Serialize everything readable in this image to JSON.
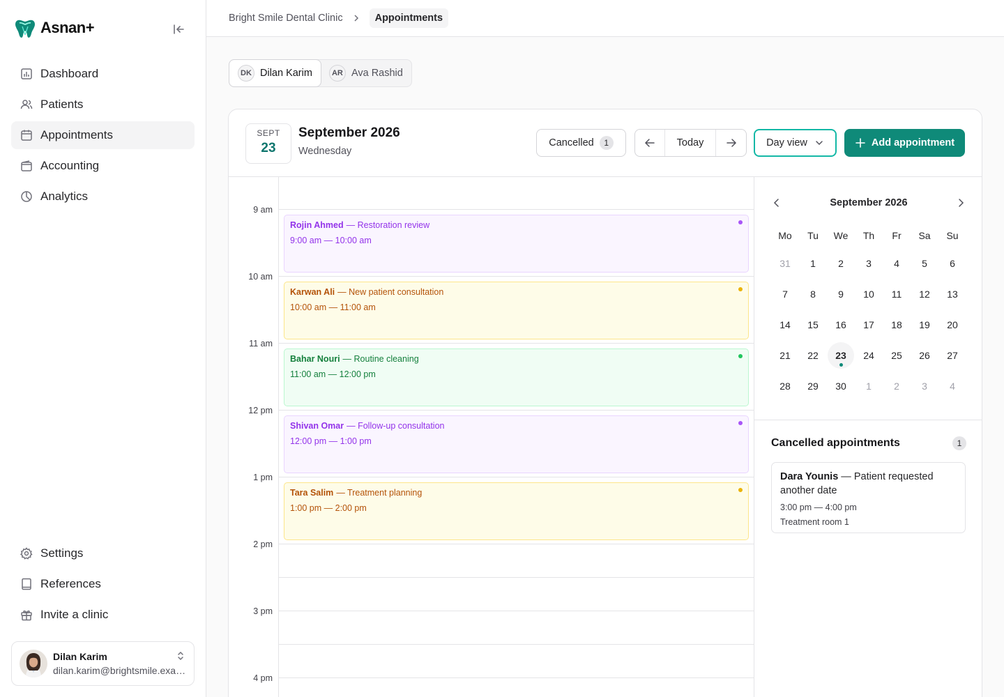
{
  "brand": {
    "name": "Asnan+"
  },
  "sidebar": {
    "items": [
      {
        "label": "Dashboard",
        "icon": "chart-icon"
      },
      {
        "label": "Patients",
        "icon": "users-icon"
      },
      {
        "label": "Appointments",
        "icon": "calendar-icon",
        "active": true
      },
      {
        "label": "Accounting",
        "icon": "wallet-icon"
      },
      {
        "label": "Analytics",
        "icon": "pie-chart-icon"
      }
    ],
    "bottom_items": [
      {
        "label": "Settings",
        "icon": "gear-icon"
      },
      {
        "label": "References",
        "icon": "book-icon"
      },
      {
        "label": "Invite a clinic",
        "icon": "gift-icon"
      }
    ],
    "user": {
      "name": "Dilan Karim",
      "email": "dilan.karim@brightsmile.example"
    }
  },
  "breadcrumb": {
    "clinic": "Bright Smile Dental Clinic",
    "current": "Appointments"
  },
  "doctors": [
    {
      "initials": "DK",
      "name": "Dilan Karim",
      "active": true
    },
    {
      "initials": "AR",
      "name": "Ava Rashid",
      "active": false
    }
  ],
  "calendar_header": {
    "badge_month": "SEPT",
    "badge_day": "23",
    "title": "September 2026",
    "weekday": "Wednesday",
    "cancelled_label": "Cancelled",
    "cancelled_count": "1",
    "today_label": "Today",
    "view_label": "Day view",
    "add_label": "Add appointment"
  },
  "time_labels": [
    "9 am",
    "10 am",
    "11 am",
    "12 pm",
    "1 pm",
    "2 pm",
    "3 pm",
    "4 pm"
  ],
  "events": [
    {
      "patient": "Rojin Ahmed",
      "title": "— Restoration review",
      "time": "9:00 am — 10:00 am",
      "color": "purple"
    },
    {
      "patient": "Karwan Ali",
      "title": "— New patient consultation",
      "time": "10:00 am — 11:00 am",
      "color": "yellow"
    },
    {
      "patient": "Bahar Nouri",
      "title": "— Routine cleaning",
      "time": "11:00 am — 12:00 pm",
      "color": "green"
    },
    {
      "patient": "Shivan Omar",
      "title": "— Follow-up consultation",
      "time": "12:00 pm — 1:00 pm",
      "color": "purple"
    },
    {
      "patient": "Tara Salim",
      "title": "— Treatment planning",
      "time": "1:00 pm — 2:00 pm",
      "color": "yellow"
    }
  ],
  "mini_calendar": {
    "title": "September 2026",
    "weekdays": [
      "Mo",
      "Tu",
      "We",
      "Th",
      "Fr",
      "Sa",
      "Su"
    ],
    "days": [
      {
        "n": "31",
        "muted": true
      },
      {
        "n": "1"
      },
      {
        "n": "2"
      },
      {
        "n": "3"
      },
      {
        "n": "4"
      },
      {
        "n": "5"
      },
      {
        "n": "6"
      },
      {
        "n": "7"
      },
      {
        "n": "8"
      },
      {
        "n": "9"
      },
      {
        "n": "10"
      },
      {
        "n": "11"
      },
      {
        "n": "12"
      },
      {
        "n": "13"
      },
      {
        "n": "14"
      },
      {
        "n": "15"
      },
      {
        "n": "16"
      },
      {
        "n": "17"
      },
      {
        "n": "18"
      },
      {
        "n": "19"
      },
      {
        "n": "20"
      },
      {
        "n": "21"
      },
      {
        "n": "22"
      },
      {
        "n": "23",
        "today": true
      },
      {
        "n": "24"
      },
      {
        "n": "25"
      },
      {
        "n": "26"
      },
      {
        "n": "27"
      },
      {
        "n": "28"
      },
      {
        "n": "29"
      },
      {
        "n": "30"
      },
      {
        "n": "1",
        "muted": true
      },
      {
        "n": "2",
        "muted": true
      },
      {
        "n": "3",
        "muted": true
      },
      {
        "n": "4",
        "muted": true
      }
    ]
  },
  "cancelled_panel": {
    "title": "Cancelled appointments",
    "count": "1",
    "item": {
      "patient": "Dara Younis",
      "reason": " — Patient requested another date",
      "time": "3:00 pm — 4:00 pm",
      "room": "Treatment room 1"
    }
  }
}
